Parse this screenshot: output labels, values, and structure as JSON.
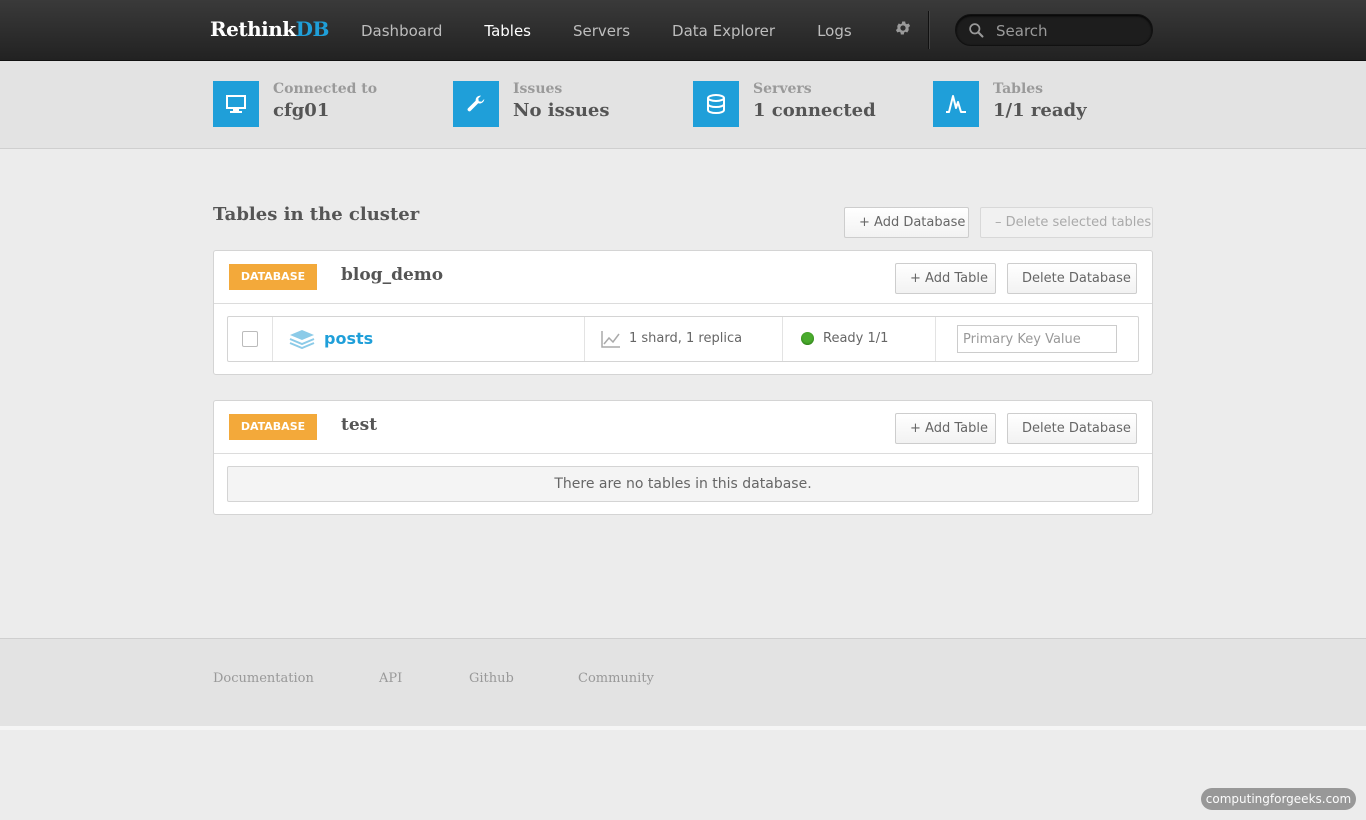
{
  "brand": {
    "part1": "Rethink",
    "part2": "DB"
  },
  "nav": {
    "items": [
      "Dashboard",
      "Tables",
      "Servers",
      "Data Explorer",
      "Logs"
    ],
    "active": "Tables",
    "settings_icon": "gear-icon"
  },
  "search": {
    "placeholder": "Search"
  },
  "stats": [
    {
      "label": "Connected to",
      "value": "cfg01",
      "icon": "monitor-icon"
    },
    {
      "label": "Issues",
      "value": "No issues",
      "icon": "wrench-icon"
    },
    {
      "label": "Servers",
      "value": "1 connected",
      "icon": "database-icon"
    },
    {
      "label": "Tables",
      "value": "1/1 ready",
      "icon": "activity-icon"
    }
  ],
  "main": {
    "heading": "Tables in the cluster",
    "add_database": "+ Add Database",
    "delete_selected": "– Delete selected tables"
  },
  "databases": [
    {
      "badge": "DATABASE",
      "name": "blog_demo",
      "add_table": "+ Add Table",
      "delete_db": "Delete Database",
      "tables": [
        {
          "name": "posts",
          "shards": "1 shard, 1 replica",
          "status": "Ready 1/1",
          "pk_placeholder": "Primary Key Value"
        }
      ]
    },
    {
      "badge": "DATABASE",
      "name": "test",
      "add_table": "+ Add Table",
      "delete_db": "Delete Database",
      "empty_text": "There are no tables in this database."
    }
  ],
  "footer": {
    "links": [
      "Documentation",
      "API",
      "Github",
      "Community"
    ]
  },
  "watermark": "computingforgeeks.com",
  "colors": {
    "accent": "#1f9fd9",
    "badge": "#f3a93a",
    "ready": "#4aab2e"
  }
}
